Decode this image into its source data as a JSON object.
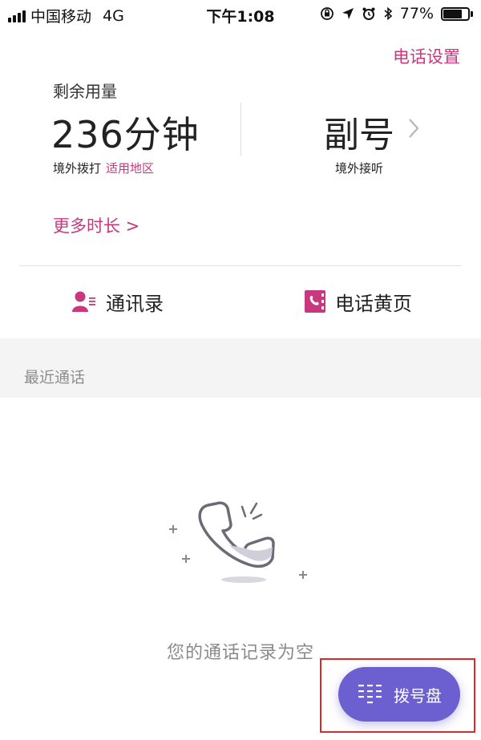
{
  "status_bar": {
    "carrier": "中国移动",
    "network": "4G",
    "time": "下午1:08",
    "battery_percent": "77%",
    "battery_level": 0.77,
    "icons": [
      "orientation-lock-icon",
      "location-icon",
      "alarm-icon",
      "bluetooth-icon"
    ]
  },
  "header": {
    "settings_label": "电话设置"
  },
  "usage": {
    "remaining_label": "剩余用量",
    "minutes": "236分钟",
    "dial_label": "境外拨打",
    "region_link": "适用地区",
    "secondary_number": "副号",
    "answer_label": "境外接听",
    "more_duration": "更多时长 >"
  },
  "shortcuts": {
    "contacts": "通讯录",
    "yellow_pages": "电话黄页"
  },
  "recent": {
    "title": "最近通话",
    "empty_message": "您的通话记录为空"
  },
  "dialpad": {
    "label": "拨号盘"
  },
  "colors": {
    "accent": "#c8387f",
    "dialpad_bg": "#6c5fd0",
    "highlight": "#d92a2a"
  }
}
